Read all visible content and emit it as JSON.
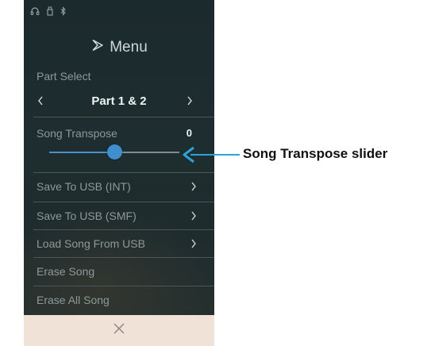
{
  "status_icons": [
    "headphones-icon",
    "usb-memory-icon",
    "bluetooth-icon"
  ],
  "header": {
    "icon": "play-outline-icon",
    "title": "Menu"
  },
  "part_select": {
    "label": "Part Select",
    "value": "Part 1 & 2",
    "prev_icon": "chevron-left-icon",
    "next_icon": "chevron-right-icon"
  },
  "song_transpose": {
    "label": "Song Transpose",
    "value": "0",
    "slider_level": 0.5
  },
  "menu_items": [
    {
      "label": "Save To USB (INT)",
      "has_chevron": true
    },
    {
      "label": "Save To USB (SMF)",
      "has_chevron": true
    },
    {
      "label": "Load Song From USB",
      "has_chevron": true
    },
    {
      "label": "Erase Song",
      "has_chevron": false
    },
    {
      "label": "Erase All Song",
      "has_chevron": false
    }
  ],
  "close_icon": "close-x-icon",
  "annotation": {
    "label": "Song Transpose slider"
  },
  "colors": {
    "panel_bg": "#1e2d2f",
    "accent_blue": "#3f8fd0",
    "close_bar_bg": "#f0e2d6",
    "label_gray": "#8e9999"
  }
}
